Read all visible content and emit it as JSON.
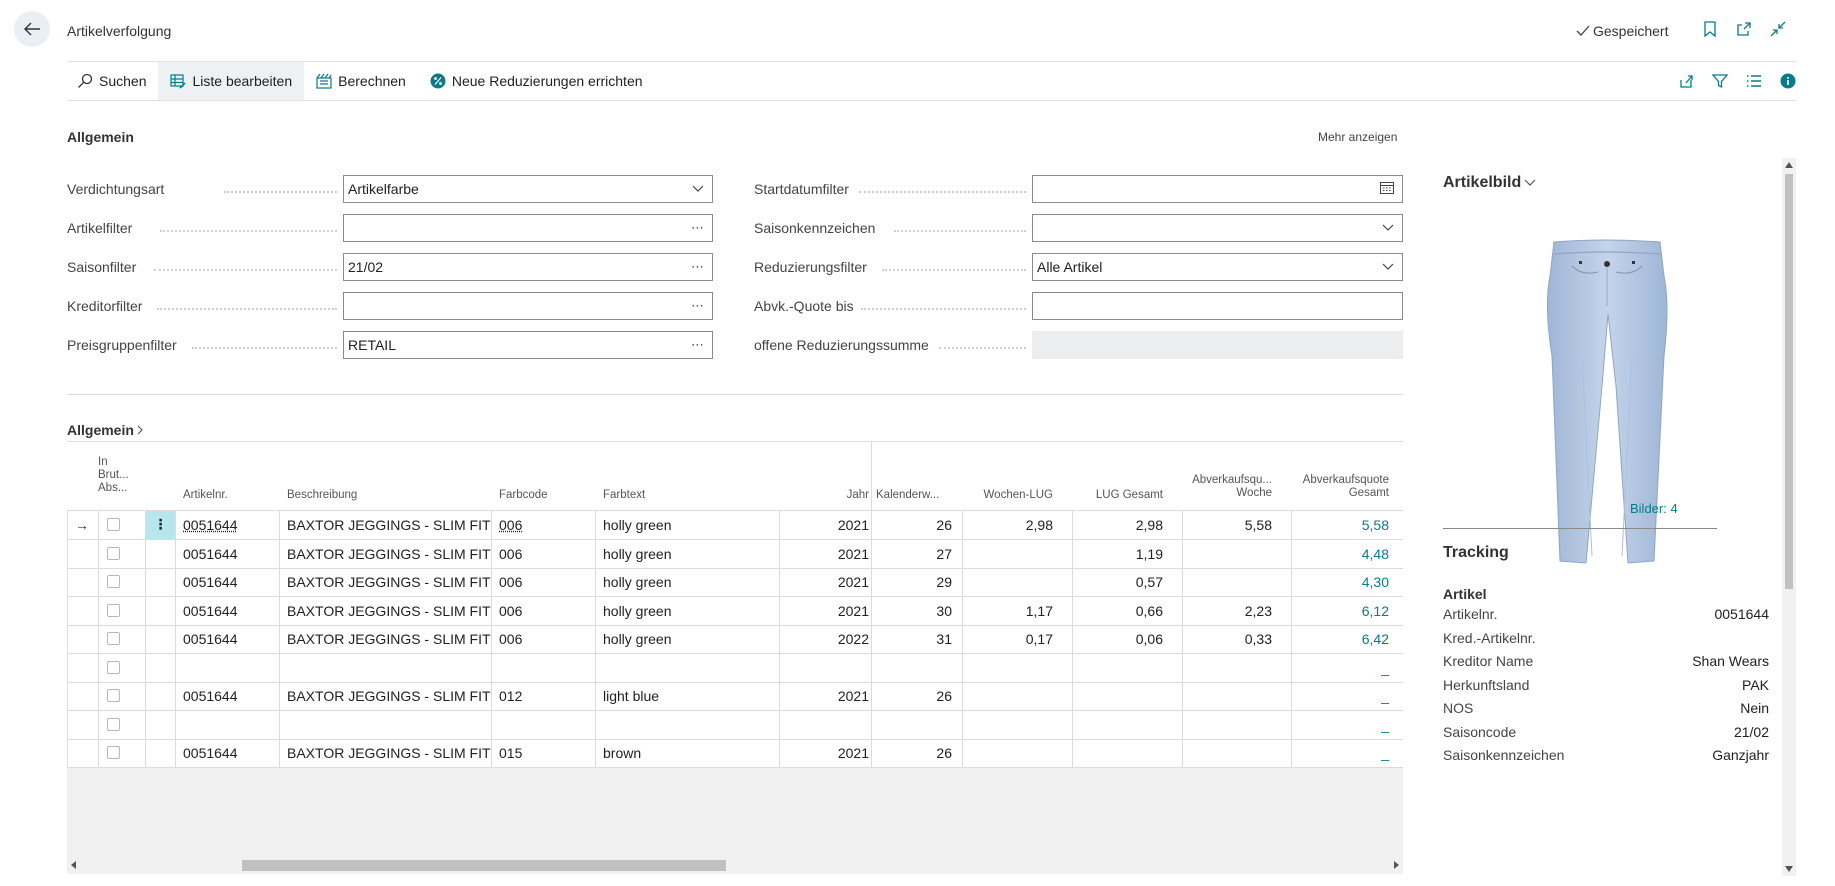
{
  "header": {
    "title": "Artikelverfolgung",
    "saved_label": "Gespeichert"
  },
  "actions": {
    "search": "Suchen",
    "edit_list": "Liste bearbeiten",
    "calculate": "Berechnen",
    "new_reductions": "Neue Reduzierungen errichten"
  },
  "general": {
    "title": "Allgemein",
    "more": "Mehr anzeigen",
    "left_fields": [
      {
        "label": "Verdichtungsart",
        "value": "Artikelfarbe",
        "control": "dropdown"
      },
      {
        "label": "Artikelfilter",
        "value": "",
        "control": "lookup"
      },
      {
        "label": "Saisonfilter",
        "value": "21/02",
        "control": "lookup"
      },
      {
        "label": "Kreditorfilter",
        "value": "",
        "control": "lookup"
      },
      {
        "label": "Preisgruppenfilter",
        "value": "RETAIL",
        "control": "lookup"
      }
    ],
    "right_fields": [
      {
        "label": "Startdatumfilter",
        "value": "",
        "control": "date"
      },
      {
        "label": "Saisonkennzeichen",
        "value": "",
        "control": "dropdown"
      },
      {
        "label": "Reduzierungsfilter",
        "value": "Alle Artikel",
        "control": "dropdown"
      },
      {
        "label": "Abvk.-Quote bis",
        "value": "",
        "control": "text"
      },
      {
        "label": "offene Reduzierungssumme",
        "value": "",
        "control": "readonly"
      }
    ]
  },
  "lines": {
    "title": "Allgemein",
    "columns": {
      "in_brut": "In Brut... Abs...",
      "item_no": "Artikelnr.",
      "description": "Beschreibung",
      "color_code": "Farbcode",
      "color_text": "Farbtext",
      "year": "Jahr",
      "week": "Kalenderw...",
      "week_lug": "Wochen-LUG",
      "lug_total": "LUG Gesamt",
      "sell_through_week": "Abverkaufsqu... Woche",
      "sell_through_total": "Abverkaufsquote Gesamt"
    },
    "rows": [
      {
        "item_no": "0051644",
        "description": "BAXTOR JEGGINGS - SLIM FIT",
        "color_code": "006",
        "color_text": "holly green",
        "year": "2021",
        "week": "26",
        "week_lug": "2,98",
        "lug_total": "2,98",
        "st_week": "5,58",
        "st_total": "5,58"
      },
      {
        "item_no": "0051644",
        "description": "BAXTOR JEGGINGS - SLIM FIT",
        "color_code": "006",
        "color_text": "holly green",
        "year": "2021",
        "week": "27",
        "week_lug": "",
        "lug_total": "1,19",
        "st_week": "",
        "st_total": "4,48"
      },
      {
        "item_no": "0051644",
        "description": "BAXTOR JEGGINGS - SLIM FIT",
        "color_code": "006",
        "color_text": "holly green",
        "year": "2021",
        "week": "29",
        "week_lug": "",
        "lug_total": "0,57",
        "st_week": "",
        "st_total": "4,30"
      },
      {
        "item_no": "0051644",
        "description": "BAXTOR JEGGINGS - SLIM FIT",
        "color_code": "006",
        "color_text": "holly green",
        "year": "2021",
        "week": "30",
        "week_lug": "1,17",
        "lug_total": "0,66",
        "st_week": "2,23",
        "st_total": "6,12"
      },
      {
        "item_no": "0051644",
        "description": "BAXTOR JEGGINGS - SLIM FIT",
        "color_code": "006",
        "color_text": "holly green",
        "year": "2022",
        "week": "31",
        "week_lug": "0,17",
        "lug_total": "0,06",
        "st_week": "0,33",
        "st_total": "6,42"
      },
      {
        "item_no": "",
        "description": "",
        "color_code": "",
        "color_text": "",
        "year": "",
        "week": "",
        "week_lug": "",
        "lug_total": "",
        "st_week": "",
        "st_total": "_"
      },
      {
        "item_no": "0051644",
        "description": "BAXTOR JEGGINGS - SLIM FIT",
        "color_code": "012",
        "color_text": "light blue",
        "year": "2021",
        "week": "26",
        "week_lug": "",
        "lug_total": "",
        "st_week": "",
        "st_total": "_"
      },
      {
        "item_no": "",
        "description": "",
        "color_code": "",
        "color_text": "",
        "year": "",
        "week": "",
        "week_lug": "",
        "lug_total": "",
        "st_week": "",
        "st_total": "_"
      },
      {
        "item_no": "0051644",
        "description": "BAXTOR JEGGINGS - SLIM FIT",
        "color_code": "015",
        "color_text": "brown",
        "year": "2021",
        "week": "26",
        "week_lug": "",
        "lug_total": "",
        "st_week": "",
        "st_total": "_"
      }
    ]
  },
  "factbox": {
    "picture_title": "Artikelbild",
    "pictures_count": "Bilder: 4",
    "tracking_title": "Tracking",
    "item_group": "Artikel",
    "details": [
      {
        "label": "Artikelnr.",
        "value": "0051644",
        "link": true
      },
      {
        "label": "Kred.-Artikelnr.",
        "value": ""
      },
      {
        "label": "Kreditor Name",
        "value": "Shan Wears"
      },
      {
        "label": "Herkunftsland",
        "value": "PAK"
      },
      {
        "label": "NOS",
        "value": "Nein"
      },
      {
        "label": "Saisoncode",
        "value": "21/02"
      },
      {
        "label": "Saisonkennzeichen",
        "value": "Ganzjahr"
      }
    ]
  },
  "colors": {
    "accent": "#0a7a8a",
    "selected_cell": "#b7e6ee",
    "toolbar_active": "#eef1f4"
  }
}
